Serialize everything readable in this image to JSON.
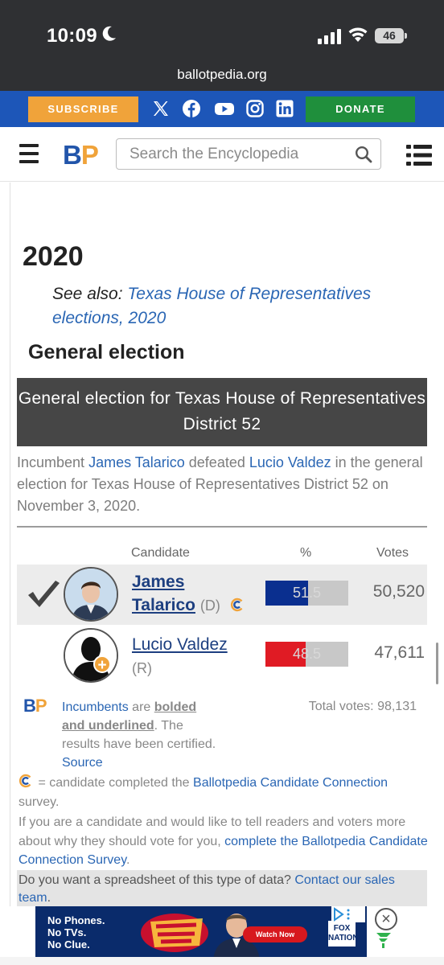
{
  "status": {
    "time": "10:09",
    "battery": "46"
  },
  "browser": {
    "url": "ballotpedia.org"
  },
  "promo": {
    "subscribe": "SUBSCRIBE",
    "donate": "DONATE"
  },
  "header": {
    "logo_b": "B",
    "logo_p": "P",
    "search_placeholder": "Search the Encyclopedia"
  },
  "section": {
    "year": "2020",
    "see_also_label": "See also:",
    "see_also_link": "Texas House of Representatives elections, 2020",
    "heading": "General election"
  },
  "race": {
    "title": "General election for Texas House of Representatives District 52",
    "summary": {
      "t1": "Incumbent ",
      "winner": "James Talarico",
      "t2": " defeated ",
      "loser": "Lucio Valdez",
      "t3": " in the general election for Texas House of Representatives District 52 on November 3, 2020."
    },
    "columns": {
      "candidate": "Candidate",
      "percent": "%",
      "votes": "Votes"
    },
    "candidates": [
      {
        "first": "James",
        "last": "Talarico",
        "party": "(D)",
        "percent": 51.5,
        "percent_label": "51.5",
        "votes": "50,520",
        "winner": true,
        "color": "#0a2f8f"
      },
      {
        "name": "Lucio Valdez",
        "party": "(R)",
        "percent": 48.5,
        "percent_label": "48.5",
        "votes": "47,611",
        "winner": false,
        "color": "#e01b24"
      }
    ]
  },
  "legend": {
    "logo_b": "B",
    "logo_p": "P",
    "incumbents": "Incumbents",
    "are": " are ",
    "bolded": "bolded",
    "and": " ",
    "underlined": "and underlined",
    "certified": ". The results have been certified. ",
    "source": "Source",
    "total": "Total votes: 98,131",
    "cc_text": " = candidate completed the ",
    "cc_link": "Ballotpedia Candidate Connection",
    "cc_end": " survey.",
    "if_text": "If you are a candidate and would like to tell readers and voters more about why they should vote for you, ",
    "if_link": "complete the Ballotpedia Candidate Connection Survey",
    "if_end": ".",
    "spread_text": "Do you want a spreadsheet of this type of data? ",
    "spread_link": "Contact our sales team",
    "spread_end": "."
  },
  "ad": {
    "line1": "No Phones.",
    "line2": "No TVs.",
    "line3": "No Clue.",
    "watch": "Watch Now",
    "fox1": "FOX",
    "fox2": "NATION",
    "close": "×"
  }
}
